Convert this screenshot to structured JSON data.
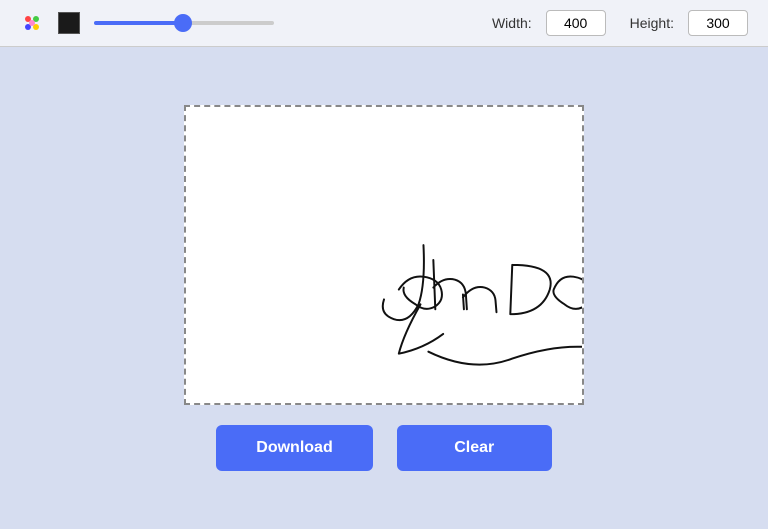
{
  "toolbar": {
    "width_label": "Width:",
    "height_label": "Height:",
    "width_value": "400",
    "height_value": "300",
    "slider_value": 50
  },
  "buttons": {
    "download_label": "Download",
    "clear_label": "Clear"
  },
  "colors": {
    "accent": "#4a6cf7",
    "brush": "#1a1a1a"
  }
}
